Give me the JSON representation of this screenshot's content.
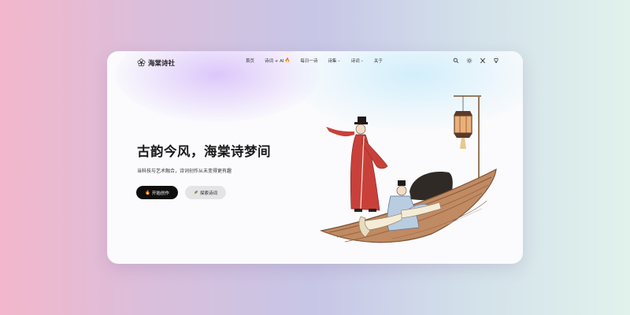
{
  "brand": {
    "name": "海棠诗社",
    "logo_icon": "flower-logo-icon"
  },
  "nav": {
    "items": [
      {
        "label": "首页",
        "has_dropdown": false
      },
      {
        "label": "诗词 + AI",
        "badge_icon": "fire-icon",
        "has_dropdown": false
      },
      {
        "label": "每日一诗",
        "has_dropdown": false
      },
      {
        "label": "诗集",
        "has_dropdown": true
      },
      {
        "label": "诗词",
        "has_dropdown": true
      },
      {
        "label": "关于",
        "has_dropdown": false
      }
    ],
    "icons": [
      "search-icon",
      "theme-sun-icon",
      "x-twitter-icon",
      "github-icon"
    ]
  },
  "hero": {
    "title": "古韵今风，海棠诗梦间",
    "subtitle": "当科技与艺术融合，诗词创作从未变得更有趣",
    "primary_button": {
      "label": "开始创作",
      "icon": "fire-icon"
    },
    "secondary_button": {
      "label": "探索诗词",
      "icon": "leaf-icon"
    }
  },
  "colors": {
    "primary_button_bg": "#0e0e0e",
    "secondary_button_bg": "#e4e4e6",
    "robe_red": "#c9403a",
    "robe_blue": "#b8cde0",
    "boat_wood": "#b07a55"
  }
}
